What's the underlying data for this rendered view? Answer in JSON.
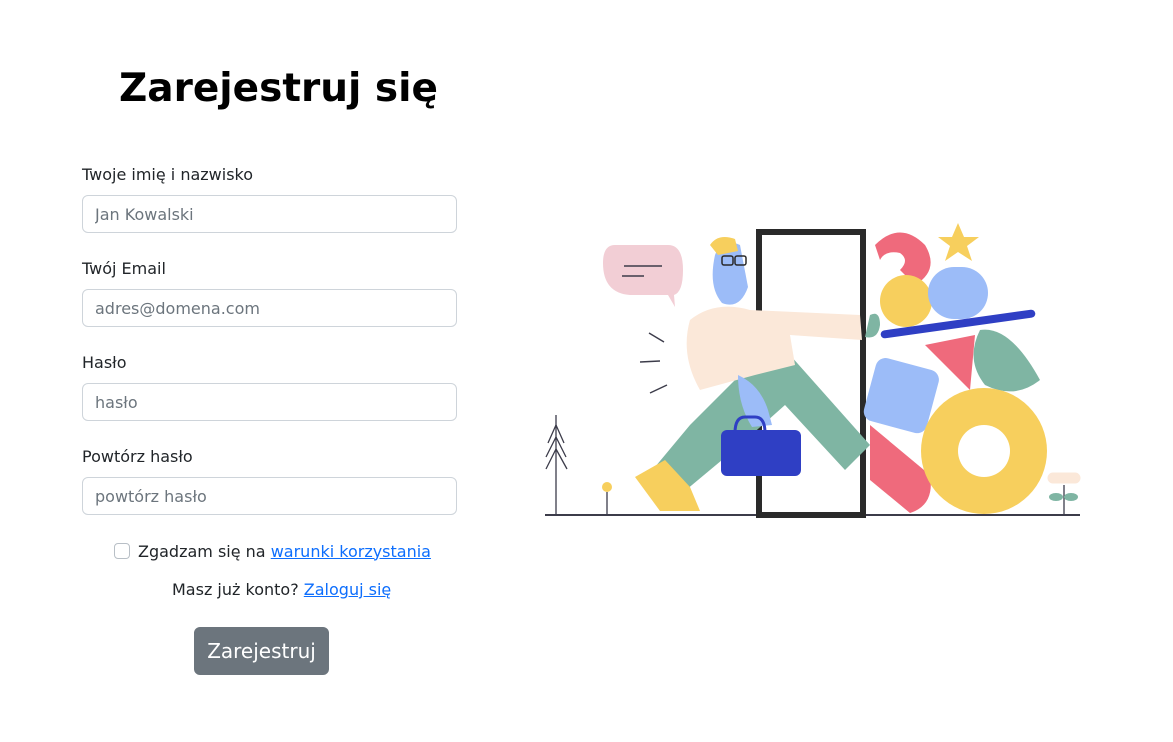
{
  "page": {
    "title": "Zarejestruj się"
  },
  "form": {
    "name_label": "Twoje imię i nazwisko",
    "name_placeholder": "Jan Kowalski",
    "name_value": "",
    "email_label": "Twój Email",
    "email_placeholder": "adres@domena.com",
    "email_value": "",
    "password_label": "Hasło",
    "password_placeholder": "hasło",
    "password_value": "",
    "repeat_label": "Powtórz hasło",
    "repeat_placeholder": "powtórz hasło",
    "repeat_value": "",
    "terms_checked": false,
    "terms_prefix": "Zgadzam się na",
    "terms_link": "warunki korzystania",
    "login_prefix": "Masz już konto?",
    "login_link": "Zaloguj się",
    "submit_label": "Zarejestruj"
  },
  "colors": {
    "link": "#0d6efd",
    "submit_bg": "#6c757d",
    "illustration_green": "#7fb5a3",
    "illustration_pink": "#ef6a7c",
    "illustration_yellow": "#f7cf5d",
    "illustration_blue": "#9cbcf8",
    "illustration_navy": "#2f3fc4"
  },
  "illustration": {
    "name": "person-walking-through-door-illustration"
  }
}
